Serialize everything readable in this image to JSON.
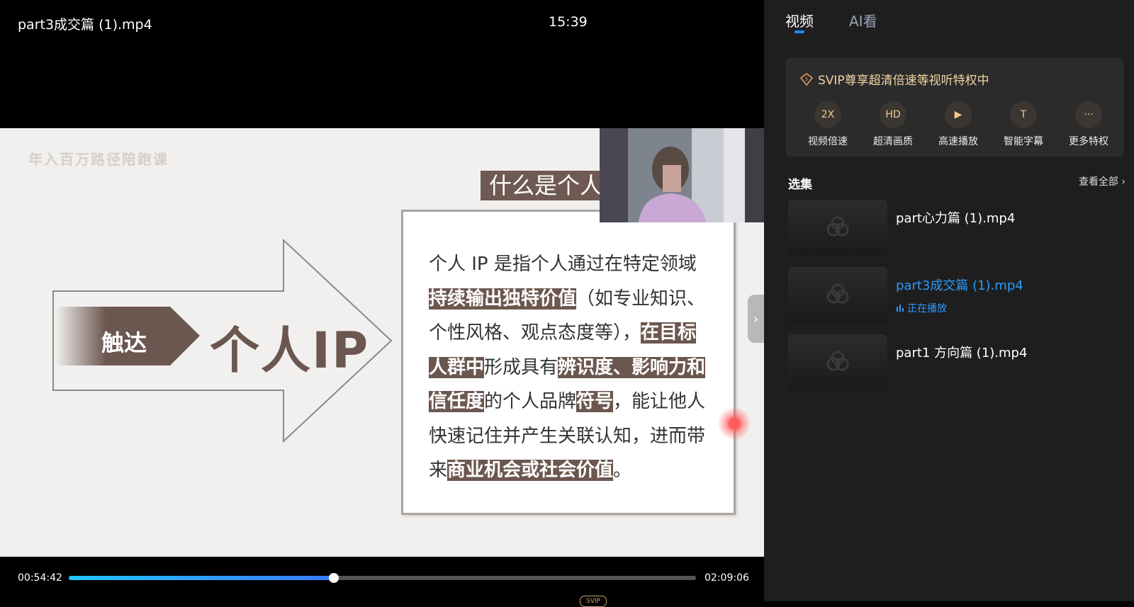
{
  "player": {
    "title": "part3成交篇 (1).mp4",
    "clock": "15:39",
    "current_time": "00:54:42",
    "total_time": "02:09:06",
    "progress": 0.423,
    "svip_mini": "SVIP"
  },
  "slide": {
    "watermark": "年入百万路径陪跑课",
    "title_strip": "什么是个人",
    "touch_label": "触达",
    "ip_heading": "个人IP",
    "definition": {
      "t1": "个人 IP 是指个人通过在特定领域",
      "h1": "持续输出独特价值",
      "t2": "（如专业知识、个性风格、观点态度等），",
      "h2": "在目标人群中",
      "t3": "形成具有",
      "h3": "辨识度、影响力和信任度",
      "t4": "的个人品牌",
      "h4": "符号",
      "t5": "，能让他人快速记住并产生关联认知，进而带来",
      "h5": "商业机会或社会价值",
      "t6": "。"
    }
  },
  "panel": {
    "tabs": {
      "video": "视频",
      "ai": "AI看"
    },
    "svip": {
      "header": "SVIP尊享超清倍速等视听特权中",
      "perks": [
        {
          "label": "视频倍速",
          "icon": "2X"
        },
        {
          "label": "超清画质",
          "icon": "HD"
        },
        {
          "label": "高速播放",
          "icon": "▶"
        },
        {
          "label": "智能字幕",
          "icon": "T"
        },
        {
          "label": "更多特权",
          "icon": "···"
        }
      ]
    },
    "episodes": {
      "title": "选集",
      "view_all": "查看全部",
      "items": [
        {
          "title": "part心力篇 (1).mp4",
          "status": ""
        },
        {
          "title": "part3成交篇 (1).mp4",
          "status": "正在播放"
        },
        {
          "title": "part1 方向篇 (1).mp4",
          "status": ""
        }
      ]
    }
  }
}
